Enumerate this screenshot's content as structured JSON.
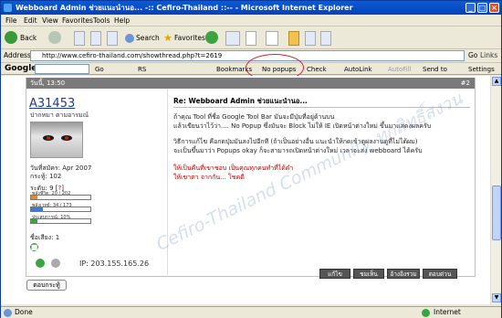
{
  "window": {
    "title": "Webboard Admin ช่วยแนะนำนอ... -:: Cefiro-Thailand ::-- - Microsoft Internet Explorer"
  },
  "menu": [
    "File",
    "Edit",
    "View",
    "Favorites",
    "Tools",
    "Help"
  ],
  "toolbar": {
    "back": "Back",
    "search": "Search",
    "favorites": "Favorites"
  },
  "address": {
    "label": "Address",
    "url": "http://www.cefiro-thailand.com/showthread.php?t=2619",
    "go": "Go",
    "links": "Links"
  },
  "googlebar": {
    "logo": "Google",
    "items": [
      "Go",
      "RS",
      "Bookmarks",
      "No popups",
      "Check",
      "AutoLink",
      "AutoFill",
      "Send to",
      "Settings"
    ]
  },
  "post": {
    "header_time": "วันนี้, 13:50",
    "number": "#2",
    "username": "A31453",
    "user_title": "ปากหมา ตามอารมณ์",
    "join_date": "วันที่สมัคร: Apr 2007",
    "posts": "กระทู้: 102",
    "level_label": "ระดับ: 9 [",
    "level_value": "?",
    "level_close": "]",
    "hp": {
      "label": "พลังชีวิต: 20 / 202",
      "fraction": 0.1,
      "color": "#e0893a"
    },
    "mp": {
      "label": "พลังเวทย์: 34 / 173",
      "fraction": 0.2,
      "color": "#3e7ad1"
    },
    "exp": {
      "label": "ประสบการณ์: 10%",
      "fraction": 0.1,
      "color": "#3aa540"
    },
    "reputation": "ชื่อเสียง: 1",
    "ip": "IP: 203.155.165.26",
    "title": "Re: Webboard Admin ช่วยแนะนำนอ...",
    "lines": [
      "ถ้าคุณ Tool ที่ชื่อ Google Tool Bar มันจะมีปุ่มที่อยู่ด้านบน",
      "แล้วเขียนว่าไว้ว่า.... No Popup ซึ่งมันจะ Block ไม่ให้ IE เปิดหน้าต่างใหม่ ขึ้นมาแสดงผลครับ",
      "วิธีการแก้ไข คือกดปุ่มมันลงไปอีกที (ถ้าเป็นอย่างอื่น แนะนำให้กดเข้าดูผลงานดูที่ไม่ได้ผม)",
      "จะเป็นขึ้นมาว่า Popups okay ก็จะสามารถเปิดหน้าต่างใหม่ เวลาจะส่ง webboard ได้ครับ",
      "ให้เป็นคืนที่เขาชอบ เป็นคุณทุกคนทำที่ได้ดำ",
      "ให้เขาตา จากกัน... โชคดี"
    ],
    "buttons": [
      "แก้ไข",
      "ชมเห็น",
      "อ้างอิงรวม",
      "ตอบด่วน"
    ]
  },
  "watermark": "Cefiro-Thailand Community ทุกสิทธิ์สงวน",
  "bottom_tab": "ตอบกระทู้",
  "status": {
    "done": "Done",
    "zone": "Internet"
  }
}
